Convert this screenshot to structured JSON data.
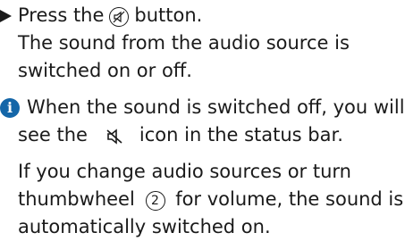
{
  "step": {
    "line1_before": "Press the",
    "line1_after": "button.",
    "line2": "The sound from the audio source is",
    "line3": "switched on or off."
  },
  "note": {
    "line1": "When the sound is switched off, you will",
    "line2_before": "see the",
    "line2_after": "icon in the status bar.",
    "para2_line1": "If you change audio sources or turn",
    "para2_line2_before": "thumbwheel",
    "thumbwheel_number": "2",
    "para2_line2_after": "for volume, the sound is",
    "para2_line3": "automatically switched on."
  },
  "icons": {
    "arrow": "triangle-bullet-icon",
    "mute_button": "mute-button-icon",
    "info": "info-icon",
    "mute_status": "speaker-muted-icon",
    "info_color": "#1466a8"
  }
}
